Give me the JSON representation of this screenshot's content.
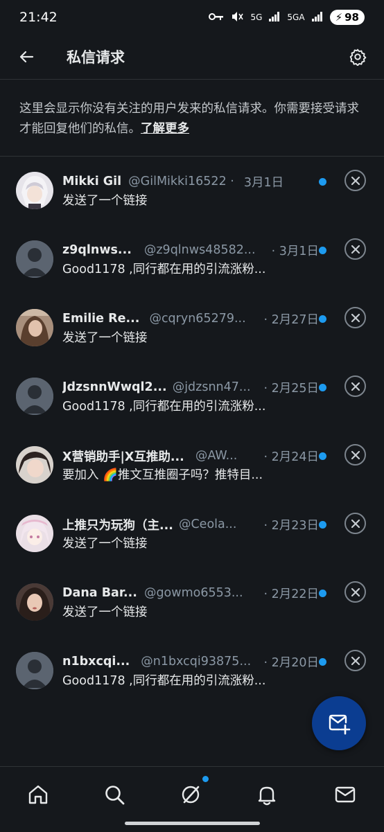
{
  "status": {
    "time": "21:42",
    "network1": "5G",
    "network2": "5GA",
    "battery": "98"
  },
  "header": {
    "title": "私信请求"
  },
  "notice": {
    "text": "这里会显示你没有关注的用户发来的私信请求。你需要接受请求才能回复他们的私信。",
    "link": "了解更多"
  },
  "requests": [
    {
      "name": "Mikki Gil",
      "handle": "@GilMikki16522 ·",
      "date": "3月1日",
      "message": "发送了一个链接",
      "avatar": "anime-white-hair"
    },
    {
      "name": "z9qlnws...",
      "handle": "@z9qlnws48582...",
      "date": "· 3月1日",
      "message": "Good1178 ,同行都在用的引流涨粉...",
      "avatar": "default"
    },
    {
      "name": "Emilie Re...",
      "handle": "@cqryn65279...",
      "date": "· 2月27日",
      "message": "发送了一个链接",
      "avatar": "photo-woman"
    },
    {
      "name": "JdzsnnWwql2...",
      "handle": "@jdzsnn47...",
      "date": "· 2月25日",
      "message": "Good1178 ,同行都在用的引流涨粉...",
      "avatar": "default"
    },
    {
      "name": "X营销助手|X互推助...",
      "handle": "@AW...",
      "date": "· 2月24日",
      "message": "要加入 🌈推文互推圈子吗？推特目...",
      "avatar": "photo-girl"
    },
    {
      "name": "上推只为玩狗（主...",
      "handle": "@Ceola...",
      "date": "· 2月23日",
      "message": "发送了一个链接",
      "avatar": "anime-pink"
    },
    {
      "name": "Dana Bar...",
      "handle": "@gowmo6553...",
      "date": "· 2月22日",
      "message": "发送了一个链接",
      "avatar": "photo-woman2"
    },
    {
      "name": "n1bxcqi...",
      "handle": "@n1bxcqi93875...",
      "date": "· 2月20日",
      "message": "Good1178 ,同行都在用的引流涨粉...",
      "avatar": "default"
    }
  ],
  "colors": {
    "background": "#15181c",
    "unread_dot": "#1d9bf0",
    "fab": "#0b3d91"
  },
  "tabs": [
    "home-icon",
    "search-icon",
    "grok-icon",
    "notifications-icon",
    "messages-icon"
  ]
}
